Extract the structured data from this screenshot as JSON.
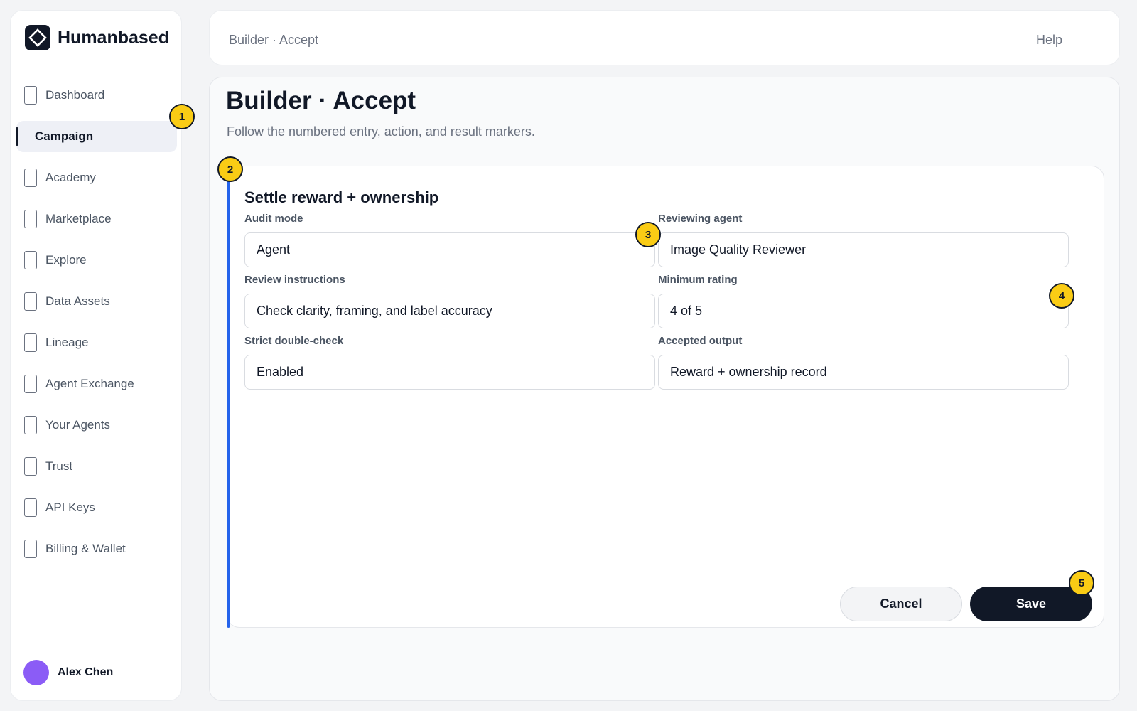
{
  "app": {
    "name": "Humanbased"
  },
  "sidebar": {
    "items": [
      {
        "label": "Dashboard",
        "active": false
      },
      {
        "label": "Campaign",
        "active": true
      },
      {
        "label": "Academy",
        "active": false
      },
      {
        "label": "Marketplace",
        "active": false
      },
      {
        "label": "Explore",
        "active": false
      },
      {
        "label": "Data Assets",
        "active": false
      },
      {
        "label": "Lineage",
        "active": false
      },
      {
        "label": "Agent Exchange",
        "active": false
      },
      {
        "label": "Your Agents",
        "active": false
      },
      {
        "label": "Trust",
        "active": false
      },
      {
        "label": "API Keys",
        "active": false
      },
      {
        "label": "Billing & Wallet",
        "active": false
      }
    ],
    "user": {
      "name": "Alex Chen",
      "avatar_color": "#8b5cf6"
    }
  },
  "topbar": {
    "breadcrumb": "Builder · Accept",
    "help_label": "Help"
  },
  "page": {
    "title": "Builder · Accept",
    "subtitle": "Follow the numbered entry, action, and result markers."
  },
  "card": {
    "title": "Settle reward + ownership",
    "accent_color": "#2563eb",
    "fields": [
      {
        "label": "Audit mode",
        "value": "Agent"
      },
      {
        "label": "Reviewing agent",
        "value": "Image Quality Reviewer"
      },
      {
        "label": "Review instructions",
        "value": "Check clarity, framing, and label accuracy"
      },
      {
        "label": "Minimum rating",
        "value": "4 of 5"
      },
      {
        "label": "Strict double-check",
        "value": "Enabled"
      },
      {
        "label": "Accepted output",
        "value": "Reward + ownership record"
      }
    ],
    "cancel_label": "Cancel",
    "save_label": "Save"
  },
  "markers": [
    "1",
    "2",
    "3",
    "4",
    "5"
  ]
}
